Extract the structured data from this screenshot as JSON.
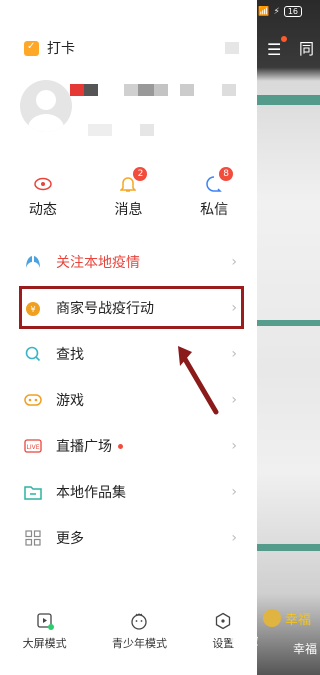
{
  "status": {
    "battery": "16"
  },
  "checkin": {
    "label": "打卡"
  },
  "quick": [
    {
      "label": "动态",
      "icon": "eye-icon"
    },
    {
      "label": "消息",
      "icon": "bell-icon",
      "badge": "2"
    },
    {
      "label": "私信",
      "icon": "chat-icon",
      "badge": "8"
    }
  ],
  "menu": [
    {
      "label": "关注本地疫情",
      "icon": "lungs-icon"
    },
    {
      "label": "商家号战疫行动",
      "icon": "money-bag-icon"
    },
    {
      "label": "查找",
      "icon": "search-icon"
    },
    {
      "label": "游戏",
      "icon": "gamepad-icon"
    },
    {
      "label": "直播广场",
      "icon": "live-icon"
    },
    {
      "label": "本地作品集",
      "icon": "folder-icon"
    },
    {
      "label": "更多",
      "icon": "grid-icon"
    }
  ],
  "bottom": [
    {
      "label": "大屏模式"
    },
    {
      "label": "青少年模式"
    },
    {
      "label": "设置"
    }
  ],
  "background": {
    "tab": "同",
    "user1": "幸福",
    "user2": "幸福"
  },
  "watermark": "经验"
}
